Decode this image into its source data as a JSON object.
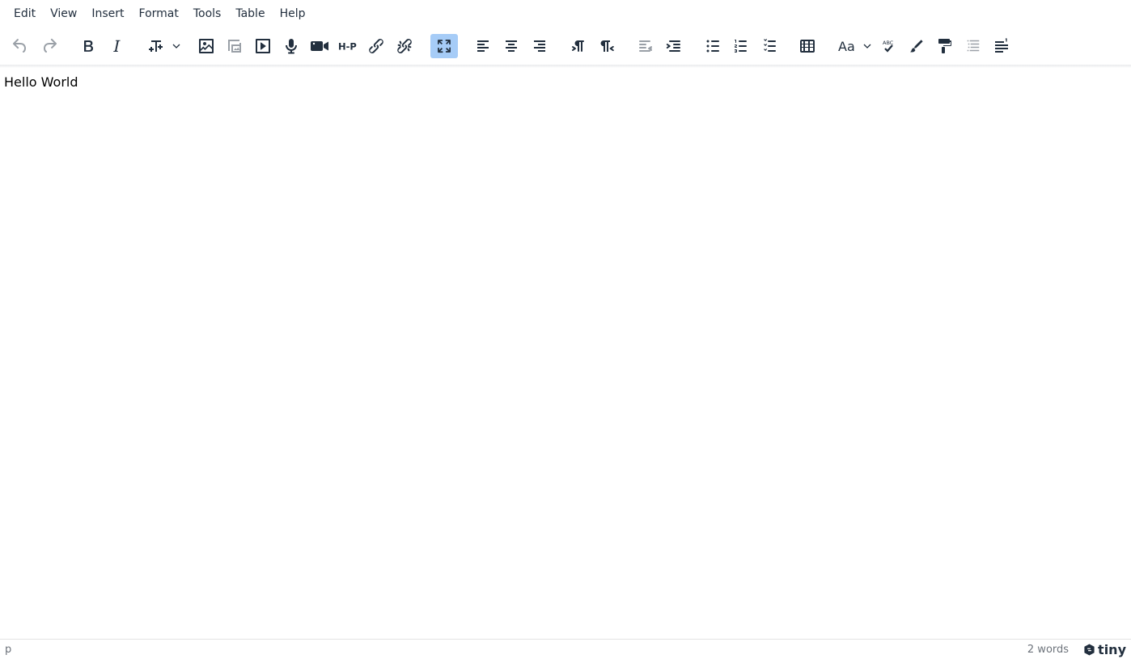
{
  "menubar": {
    "items": [
      "Edit",
      "View",
      "Insert",
      "Format",
      "Tools",
      "Table",
      "Help"
    ]
  },
  "toolbar": {
    "buttons": [
      {
        "name": "undo-icon",
        "state": "disabled"
      },
      {
        "name": "redo-icon",
        "state": "disabled"
      },
      {
        "name": "bold-icon"
      },
      {
        "name": "italic-icon"
      },
      {
        "name": "font-size-icon"
      },
      {
        "name": "image-icon"
      },
      {
        "name": "image-editor-icon",
        "state": "disabled"
      },
      {
        "name": "media-icon"
      },
      {
        "name": "record-audio-icon"
      },
      {
        "name": "record-video-icon"
      },
      {
        "name": "h5p-icon"
      },
      {
        "name": "link-icon"
      },
      {
        "name": "unlink-icon"
      },
      {
        "name": "fullscreen-icon",
        "state": "active"
      },
      {
        "name": "align-left-icon"
      },
      {
        "name": "align-center-icon"
      },
      {
        "name": "align-right-icon"
      },
      {
        "name": "ltr-icon"
      },
      {
        "name": "rtl-icon"
      },
      {
        "name": "outdent-icon",
        "state": "disabled"
      },
      {
        "name": "indent-icon"
      },
      {
        "name": "bullet-list-icon"
      },
      {
        "name": "numbered-list-icon"
      },
      {
        "name": "checklist-icon"
      },
      {
        "name": "table-icon"
      },
      {
        "name": "change-case-icon"
      },
      {
        "name": "spellcheck-icon"
      },
      {
        "name": "highlight-icon"
      },
      {
        "name": "format-painter-icon"
      },
      {
        "name": "toc-icon",
        "state": "disabled"
      },
      {
        "name": "line-height-icon"
      }
    ],
    "labels": {
      "h5p": "H-P",
      "abc": "ABC"
    }
  },
  "editor": {
    "content": "Hello World"
  },
  "statusbar": {
    "path": "p",
    "wordcount": "2 words",
    "brand": "tiny"
  },
  "colors": {
    "text": "#222f3e",
    "active_button": "#a6ccf7",
    "status_text": "#6d737b"
  }
}
